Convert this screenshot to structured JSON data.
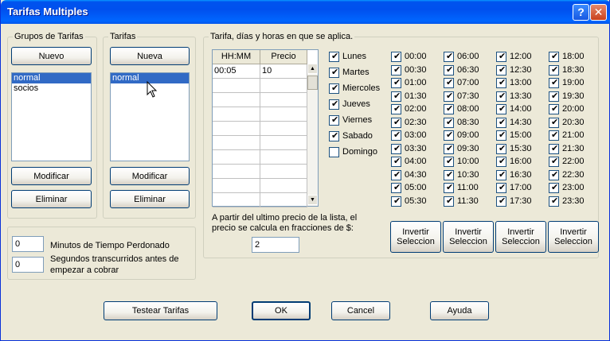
{
  "window": {
    "title": "Tarifas Multiples",
    "help_label": "?",
    "close_label": "✕"
  },
  "grupos": {
    "label": "Grupos de Tarifas",
    "new_button": "Nuevo",
    "items": [
      {
        "label": "normal",
        "selected": true
      },
      {
        "label": "socios",
        "selected": false
      }
    ],
    "modify_button": "Modificar",
    "delete_button": "Eliminar"
  },
  "tarifas": {
    "label": "Tarifas",
    "new_button": "Nueva",
    "items": [
      {
        "label": "normal",
        "selected": true
      }
    ],
    "modify_button": "Modificar",
    "delete_button": "Eliminar"
  },
  "aplica": {
    "label": "Tarifa, días y horas en que se aplica.",
    "grid": {
      "headers": [
        "HH:MM",
        "Precio"
      ],
      "rows": [
        [
          "00:05",
          "10"
        ]
      ]
    },
    "days": [
      {
        "label": "Lunes",
        "checked": true
      },
      {
        "label": "Martes",
        "checked": true
      },
      {
        "label": "Miercoles",
        "checked": true
      },
      {
        "label": "Jueves",
        "checked": true
      },
      {
        "label": "Viernes",
        "checked": true
      },
      {
        "label": "Sabado",
        "checked": true
      },
      {
        "label": "Domingo",
        "checked": false
      }
    ],
    "times": [
      [
        "00:00",
        "00:30",
        "01:00",
        "01:30",
        "02:00",
        "02:30",
        "03:00",
        "03:30",
        "04:00",
        "04:30",
        "05:00",
        "05:30"
      ],
      [
        "06:00",
        "06:30",
        "07:00",
        "07:30",
        "08:00",
        "08:30",
        "09:00",
        "09:30",
        "10:00",
        "10:30",
        "11:00",
        "11:30"
      ],
      [
        "12:00",
        "12:30",
        "13:00",
        "13:30",
        "14:00",
        "14:30",
        "15:00",
        "15:30",
        "16:00",
        "16:30",
        "17:00",
        "17:30"
      ],
      [
        "18:00",
        "18:30",
        "19:00",
        "19:30",
        "20:00",
        "20:30",
        "21:00",
        "21:30",
        "22:00",
        "22:30",
        "23:00",
        "23:30"
      ]
    ],
    "invert_button_line1": "Invertir",
    "invert_button_line2": "Seleccion",
    "fraction_label_line1": "A partir del ultimo precio de la lista, el",
    "fraction_label_line2": "precio se calcula en fracciones de $:",
    "fraction_value": "2"
  },
  "perdon": {
    "minutos_value": "0",
    "minutos_label": "Minutos de Tiempo Perdonado",
    "segundos_value": "0",
    "segundos_label_line1": "Segundos transcurridos antes de",
    "segundos_label_line2": "empezar a cobrar"
  },
  "footer": {
    "test_button": "Testear Tarifas",
    "ok_button": "OK",
    "cancel_button": "Cancel",
    "help_button": "Ayuda"
  }
}
